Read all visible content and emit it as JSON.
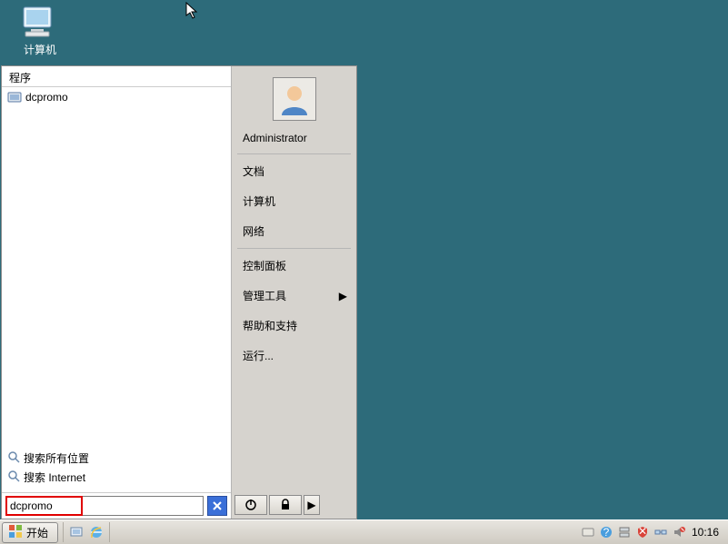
{
  "desktop": {
    "icons": {
      "computer": "计算机"
    }
  },
  "startmenu": {
    "left": {
      "header": "程序",
      "results": [
        {
          "icon": "exe-icon",
          "label": "dcpromo"
        }
      ],
      "searchLinks": {
        "everywhere": "搜索所有位置",
        "internet": "搜索 Internet"
      },
      "searchInput": {
        "value": "dcpromo",
        "placeholder": ""
      }
    },
    "right": {
      "username": "Administrator",
      "items": [
        {
          "label": "文档",
          "submenu": false
        },
        {
          "label": "计算机",
          "submenu": false
        },
        {
          "label": "网络",
          "submenu": false
        },
        {
          "label": "控制面板",
          "submenu": false
        },
        {
          "label": "管理工具",
          "submenu": true
        },
        {
          "label": "帮助和支持",
          "submenu": false
        },
        {
          "label": "运行...",
          "submenu": false
        }
      ]
    }
  },
  "taskbar": {
    "start": "开始",
    "clock": "10:16"
  }
}
